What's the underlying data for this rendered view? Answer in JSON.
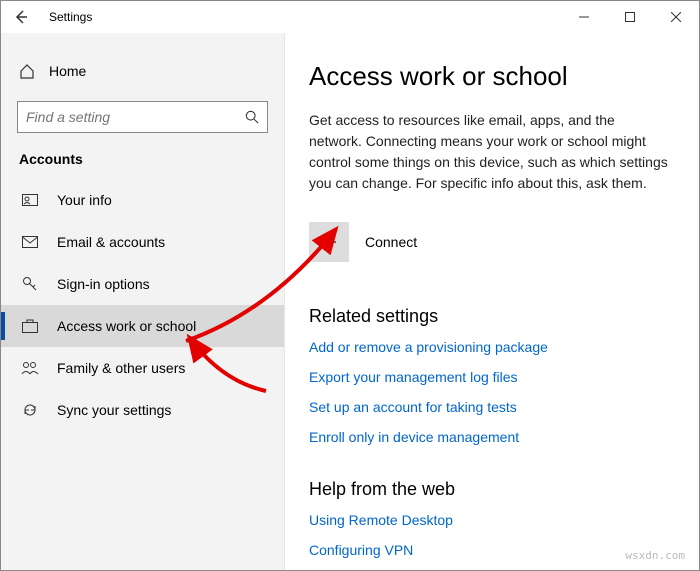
{
  "titlebar": {
    "title": "Settings"
  },
  "sidebar": {
    "home": "Home",
    "search_placeholder": "Find a setting",
    "section": "Accounts",
    "items": [
      {
        "label": "Your info"
      },
      {
        "label": "Email & accounts"
      },
      {
        "label": "Sign-in options"
      },
      {
        "label": "Access work or school"
      },
      {
        "label": "Family & other users"
      },
      {
        "label": "Sync your settings"
      }
    ]
  },
  "main": {
    "heading": "Access work or school",
    "description": "Get access to resources like email, apps, and the network. Connecting means your work or school might control some things on this device, such as which settings you can change. For specific info about this, ask them.",
    "connect_label": "Connect",
    "related_heading": "Related settings",
    "related_links": [
      "Add or remove a provisioning package",
      "Export your management log files",
      "Set up an account for taking tests",
      "Enroll only in device management"
    ],
    "help_heading": "Help from the web",
    "help_links": [
      "Using Remote Desktop",
      "Configuring VPN"
    ]
  },
  "watermark": "wsxdn.com"
}
